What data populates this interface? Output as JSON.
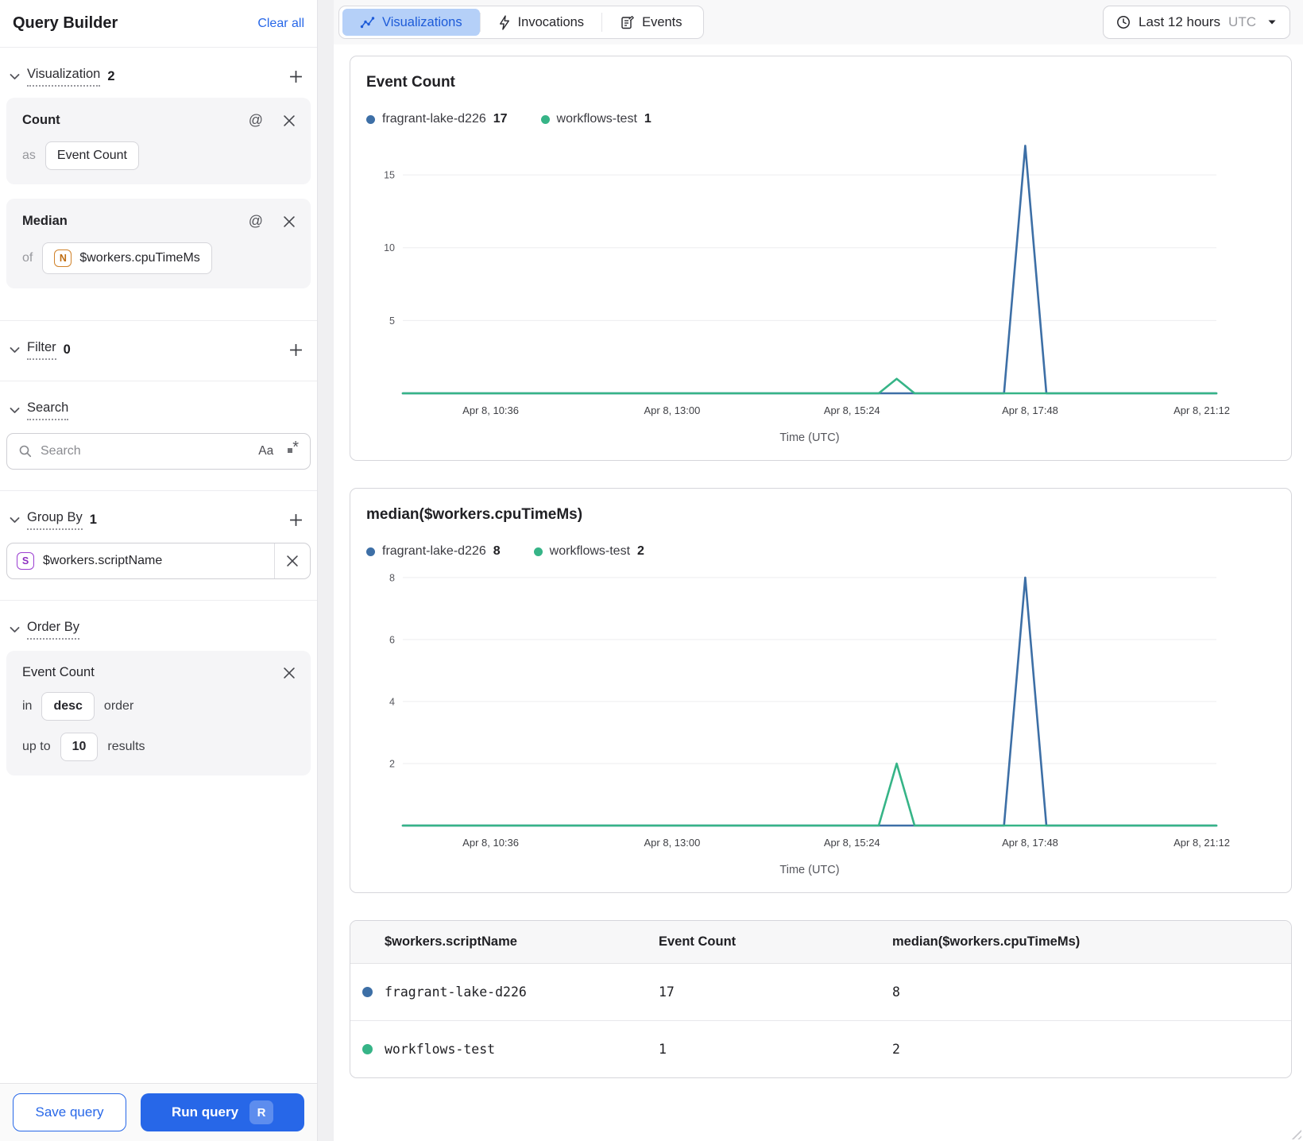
{
  "sidebar": {
    "title": "Query Builder",
    "clear_all_label": "Clear all",
    "visualization_section": {
      "label": "Visualization",
      "count": "2",
      "cards": [
        {
          "name": "Count",
          "connector": "as",
          "value": "Event Count"
        },
        {
          "name": "Median",
          "connector": "of",
          "field_type_badge": "N",
          "value": "$workers.cpuTimeMs"
        }
      ]
    },
    "filter_section": {
      "label": "Filter",
      "count": "0"
    },
    "search_section": {
      "label": "Search",
      "placeholder": "Search",
      "match_case_badge": "Aa",
      "regex_star": "*"
    },
    "group_by_section": {
      "label": "Group By",
      "count": "1",
      "items": [
        {
          "field_type_badge": "S",
          "value": "$workers.scriptName"
        }
      ]
    },
    "order_by_section": {
      "label": "Order By",
      "card": {
        "field": "Event Count",
        "in_label": "in",
        "direction": "desc",
        "order_label": "order",
        "up_to_label": "up to",
        "limit": "10",
        "results_label": "results"
      }
    },
    "footer": {
      "save_label": "Save query",
      "run_label": "Run query",
      "run_shortcut": "R"
    },
    "at_symbol": "@"
  },
  "topbar": {
    "tabs": [
      {
        "label": "Visualizations",
        "active": true
      },
      {
        "label": "Invocations",
        "active": false
      },
      {
        "label": "Events",
        "active": false
      }
    ],
    "time_range_label": "Last 12 hours",
    "timezone": "UTC"
  },
  "chart_data": [
    {
      "type": "line",
      "title": "Event Count",
      "xlabel": "Time (UTC)",
      "x_ticks": [
        "Apr 8, 10:36",
        "Apr 8, 13:00",
        "Apr 8, 15:24",
        "Apr 8, 17:48",
        "Apr 8, 21:12"
      ],
      "x_tick_fractions": [
        0.108,
        0.331,
        0.552,
        0.771,
        0.982
      ],
      "y_ticks": [
        5,
        10,
        15
      ],
      "ylim": [
        0,
        17.35
      ],
      "grid": true,
      "legend_position": "top",
      "series": [
        {
          "name": "fragrant-lake-d226",
          "total": "17",
          "color": "#3D6FA6",
          "points": [
            {
              "x": 0.0,
              "y": 0
            },
            {
              "x": 0.739,
              "y": 0
            },
            {
              "x": 0.765,
              "y": 17
            },
            {
              "x": 0.791,
              "y": 0
            },
            {
              "x": 1.0,
              "y": 0
            }
          ]
        },
        {
          "name": "workflows-test",
          "total": "1",
          "color": "#36B487",
          "points": [
            {
              "x": 0.0,
              "y": 0
            },
            {
              "x": 0.585,
              "y": 0
            },
            {
              "x": 0.607,
              "y": 1
            },
            {
              "x": 0.629,
              "y": 0
            },
            {
              "x": 1.0,
              "y": 0
            }
          ]
        }
      ]
    },
    {
      "type": "line",
      "title": "median($workers.cpuTimeMs)",
      "xlabel": "Time (UTC)",
      "x_ticks": [
        "Apr 8, 10:36",
        "Apr 8, 13:00",
        "Apr 8, 15:24",
        "Apr 8, 17:48",
        "Apr 8, 21:12"
      ],
      "x_tick_fractions": [
        0.108,
        0.331,
        0.552,
        0.771,
        0.982
      ],
      "y_ticks": [
        2,
        4,
        6,
        8
      ],
      "ylim": [
        0,
        8.15
      ],
      "grid": true,
      "legend_position": "top",
      "series": [
        {
          "name": "fragrant-lake-d226",
          "total": "8",
          "color": "#3D6FA6",
          "points": [
            {
              "x": 0.0,
              "y": 0
            },
            {
              "x": 0.739,
              "y": 0
            },
            {
              "x": 0.765,
              "y": 8
            },
            {
              "x": 0.791,
              "y": 0
            },
            {
              "x": 1.0,
              "y": 0
            }
          ]
        },
        {
          "name": "workflows-test",
          "total": "2",
          "color": "#36B487",
          "points": [
            {
              "x": 0.0,
              "y": 0
            },
            {
              "x": 0.585,
              "y": 0
            },
            {
              "x": 0.607,
              "y": 2
            },
            {
              "x": 0.629,
              "y": 0
            },
            {
              "x": 1.0,
              "y": 0
            }
          ]
        }
      ]
    }
  ],
  "table": {
    "columns": [
      "$workers.scriptName",
      "Event Count",
      "median($workers.cpuTimeMs)"
    ],
    "rows": [
      {
        "script_name": "fragrant-lake-d226",
        "event_count": "17",
        "median_cpu_time": "8",
        "color": "#3D6FA6"
      },
      {
        "script_name": "workflows-test",
        "event_count": "1",
        "median_cpu_time": "2",
        "color": "#36B487"
      }
    ]
  },
  "colors": {
    "accent_blue": "#2767E8",
    "active_tab_bg": "#B5D0F8",
    "series_blue": "#3D6FA6",
    "series_green": "#36B487"
  }
}
